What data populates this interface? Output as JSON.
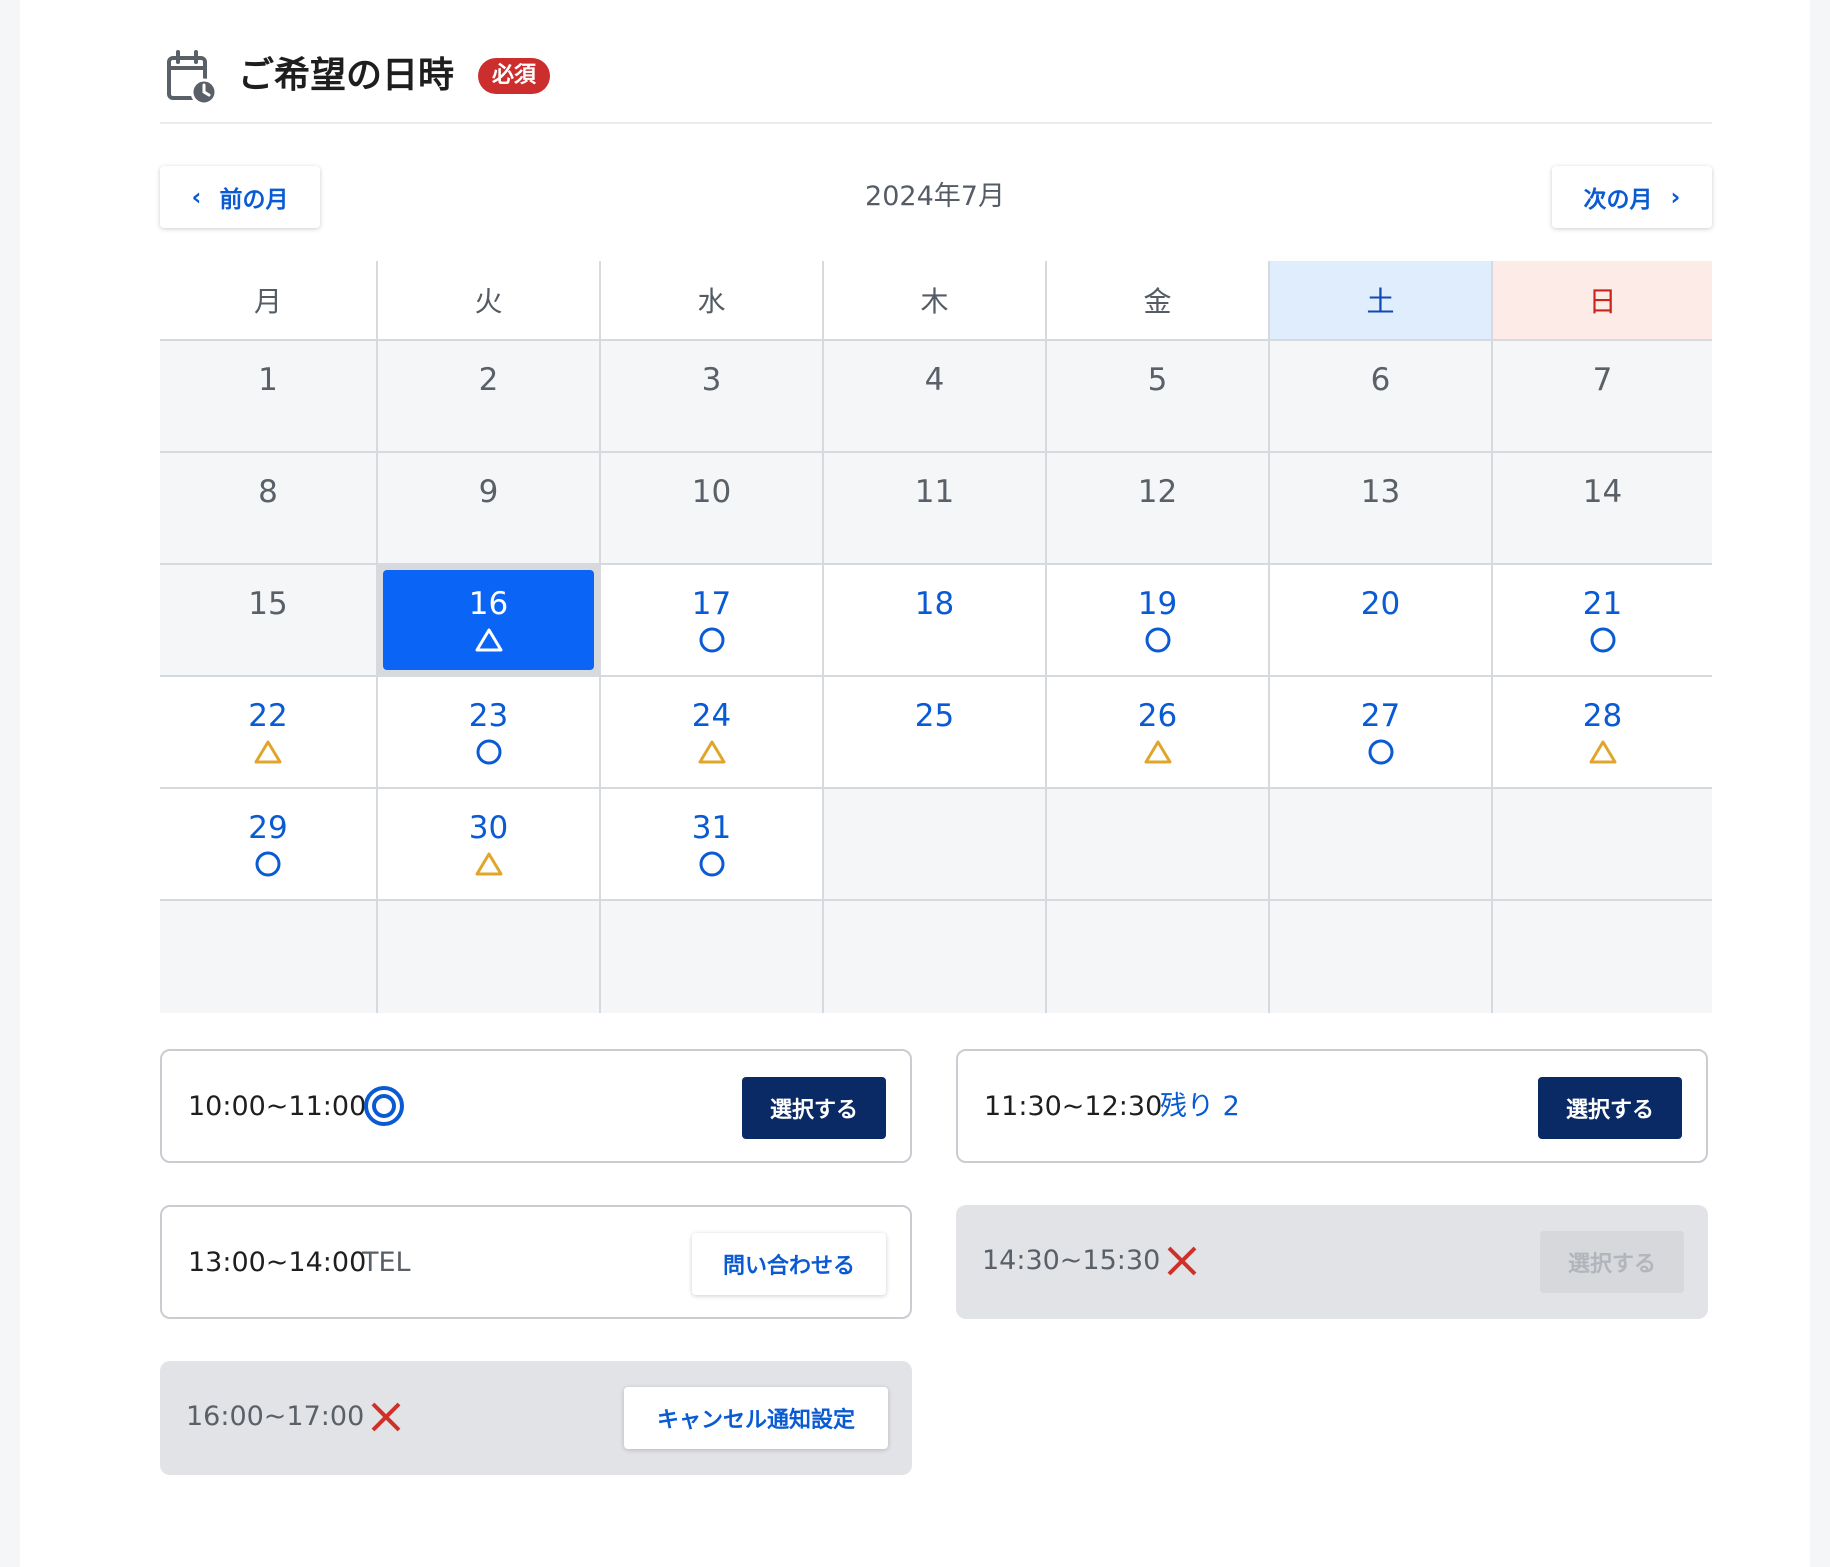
{
  "header": {
    "title": "ご希望の日時",
    "required_badge": "必須",
    "icon": "calendar-clock-icon"
  },
  "month_nav": {
    "prev_label": "前の月",
    "next_label": "次の月",
    "current_month": "2024年7月"
  },
  "weekdays": [
    "月",
    "火",
    "水",
    "木",
    "金",
    "土",
    "日"
  ],
  "colors": {
    "accent": "#0a5bd3",
    "selected": "#0a64f5",
    "primary_button": "#0a2a66",
    "sat_bg": "#e0edfc",
    "sun_bg": "#fdebe7",
    "triangle": "#e0a52a",
    "cross": "#d0302a"
  },
  "days": [
    {
      "day": "1",
      "mark": ""
    },
    {
      "day": "2",
      "mark": ""
    },
    {
      "day": "3",
      "mark": ""
    },
    {
      "day": "4",
      "mark": ""
    },
    {
      "day": "5",
      "mark": ""
    },
    {
      "day": "6",
      "mark": ""
    },
    {
      "day": "7",
      "mark": ""
    },
    {
      "day": "8",
      "mark": ""
    },
    {
      "day": "9",
      "mark": ""
    },
    {
      "day": "10",
      "mark": ""
    },
    {
      "day": "11",
      "mark": ""
    },
    {
      "day": "12",
      "mark": ""
    },
    {
      "day": "13",
      "mark": ""
    },
    {
      "day": "14",
      "mark": ""
    },
    {
      "day": "15",
      "mark": ""
    },
    {
      "day": "16",
      "mark": "triangle",
      "selected": true
    },
    {
      "day": "17",
      "mark": "circle"
    },
    {
      "day": "18",
      "mark": "none"
    },
    {
      "day": "19",
      "mark": "circle"
    },
    {
      "day": "20",
      "mark": "none"
    },
    {
      "day": "21",
      "mark": "circle"
    },
    {
      "day": "22",
      "mark": "triangle"
    },
    {
      "day": "23",
      "mark": "circle"
    },
    {
      "day": "24",
      "mark": "triangle"
    },
    {
      "day": "25",
      "mark": "none"
    },
    {
      "day": "26",
      "mark": "triangle"
    },
    {
      "day": "27",
      "mark": "circle"
    },
    {
      "day": "28",
      "mark": "triangle"
    },
    {
      "day": "29",
      "mark": "circle"
    },
    {
      "day": "30",
      "mark": "triangle"
    },
    {
      "day": "31",
      "mark": "circle"
    }
  ],
  "slots": {
    "s1": {
      "time": "10:00~11:00",
      "status": "double-circle",
      "button": "選択する"
    },
    "s2": {
      "time": "11:30~12:30",
      "note": "残り 2",
      "button": "選択する"
    },
    "s3": {
      "time": "13:00~14:00",
      "note": "TEL",
      "button": "問い合わせる"
    },
    "s4": {
      "time": "14:30~15:30",
      "status": "cross",
      "button": "選択する"
    },
    "s5": {
      "time": "16:00~17:00",
      "status": "cross",
      "button": "キャンセル通知設定"
    }
  }
}
